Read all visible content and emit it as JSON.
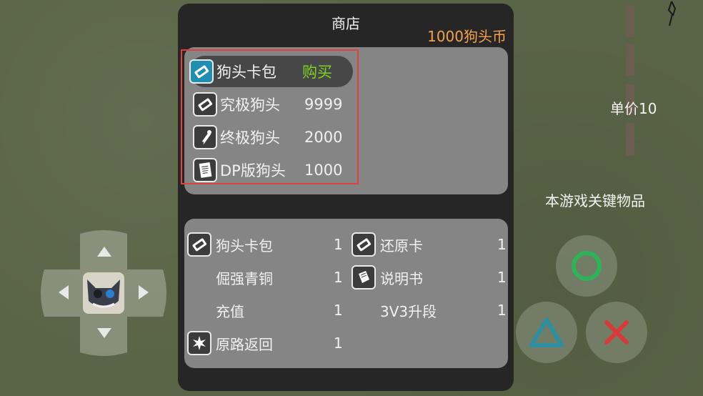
{
  "shop": {
    "title": "商店",
    "coins": "1000狗头币",
    "items": [
      {
        "name": "狗头卡包",
        "action": "购买",
        "icon": "card-pack-icon"
      },
      {
        "name": "究极狗头",
        "price": "9999",
        "icon": "card-icon"
      },
      {
        "name": "终极狗头",
        "price": "2000",
        "icon": "scroll-icon"
      },
      {
        "name": "DP版狗头",
        "price": "1000",
        "icon": "document-icon"
      }
    ]
  },
  "inventory": {
    "left": [
      {
        "name": "狗头卡包",
        "count": "1",
        "icon": "card-icon"
      },
      {
        "name": "倔强青铜",
        "count": "1",
        "icon": ""
      },
      {
        "name": "充值",
        "count": "1",
        "icon": ""
      },
      {
        "name": "原路返回",
        "count": "1",
        "icon": "return-icon"
      }
    ],
    "right": [
      {
        "name": "还原卡",
        "count": "1",
        "icon": "card-icon"
      },
      {
        "name": "说明书",
        "count": "1",
        "icon": "book-icon"
      },
      {
        "name": "3V3升段",
        "count": "1",
        "icon": ""
      }
    ]
  },
  "detail": {
    "unit_price": "单价10",
    "description": "本游戏关键物品"
  },
  "colors": {
    "coins": "#f5a24b",
    "buy": "#7ed321",
    "selection_border": "#e04040",
    "circle_button": "#2db35a",
    "triangle_button": "#2d8fa0",
    "cross_button": "#d83a3a"
  }
}
